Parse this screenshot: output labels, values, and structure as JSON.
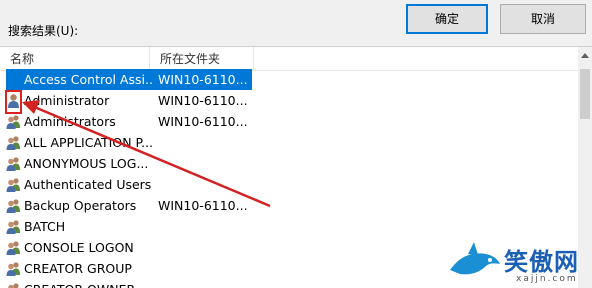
{
  "results_label": "搜索结果(U):",
  "buttons": {
    "ok": "确定",
    "cancel": "取消"
  },
  "columns": {
    "name": "名称",
    "folder": "所在文件夹"
  },
  "rows": [
    {
      "name": "Access Control Assi...",
      "folder": "WIN10-6110...",
      "icon": "group-icon",
      "selected": true
    },
    {
      "name": "Administrator",
      "folder": "WIN10-6110...",
      "icon": "user-icon",
      "selected": false
    },
    {
      "name": "Administrators",
      "folder": "WIN10-6110...",
      "icon": "group-icon",
      "selected": false
    },
    {
      "name": "ALL APPLICATION P...",
      "folder": "",
      "icon": "group-icon",
      "selected": false
    },
    {
      "name": "ANONYMOUS LOG...",
      "folder": "",
      "icon": "group-icon",
      "selected": false
    },
    {
      "name": "Authenticated Users",
      "folder": "",
      "icon": "group-icon",
      "selected": false
    },
    {
      "name": "Backup Operators",
      "folder": "WIN10-6110...",
      "icon": "group-icon",
      "selected": false
    },
    {
      "name": "BATCH",
      "folder": "",
      "icon": "group-icon",
      "selected": false
    },
    {
      "name": "CONSOLE LOGON",
      "folder": "",
      "icon": "group-icon",
      "selected": false
    },
    {
      "name": "CREATOR GROUP",
      "folder": "",
      "icon": "group-icon",
      "selected": false
    },
    {
      "name": "CREATOR OWNER",
      "folder": "",
      "icon": "group-icon",
      "selected": false
    }
  ],
  "colors": {
    "selection": "#0078d7",
    "annotation": "#d22222"
  },
  "watermark": {
    "text": "笑傲网",
    "sub": "xajjn.com"
  }
}
